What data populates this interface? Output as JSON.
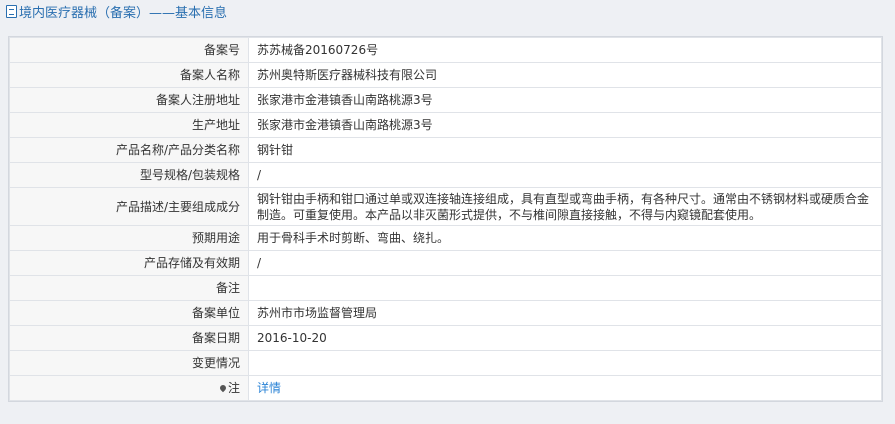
{
  "header": {
    "title": "境内医疗器械（备案）——基本信息"
  },
  "rows": [
    {
      "label": "备案号",
      "value": "苏苏械备20160726号"
    },
    {
      "label": "备案人名称",
      "value": "苏州奥特斯医疗器械科技有限公司"
    },
    {
      "label": "备案人注册地址",
      "value": "张家港市金港镇香山南路桃源3号"
    },
    {
      "label": "生产地址",
      "value": "张家港市金港镇香山南路桃源3号"
    },
    {
      "label": "产品名称/产品分类名称",
      "value": "钢针钳"
    },
    {
      "label": "型号规格/包装规格",
      "value": "/"
    },
    {
      "label": "产品描述/主要组成成分",
      "value": "钢针钳由手柄和钳口通过单或双连接轴连接组成，具有直型或弯曲手柄，有各种尺寸。通常由不锈钢材料或硬质合金制造。可重复使用。本产品以非灭菌形式提供，不与椎间隙直接接触，不得与内窥镜配套使用。"
    },
    {
      "label": "预期用途",
      "value": "用于骨科手术时剪断、弯曲、绕扎。"
    },
    {
      "label": "产品存储及有效期",
      "value": "/"
    },
    {
      "label": "备注",
      "value": ""
    },
    {
      "label": "备案单位",
      "value": "苏州市市场监督管理局"
    },
    {
      "label": "备案日期",
      "value": "2016-10-20"
    },
    {
      "label": "变更情况",
      "value": ""
    }
  ],
  "note_row": {
    "label": "注",
    "icon": "pin-icon",
    "link": "详情"
  }
}
